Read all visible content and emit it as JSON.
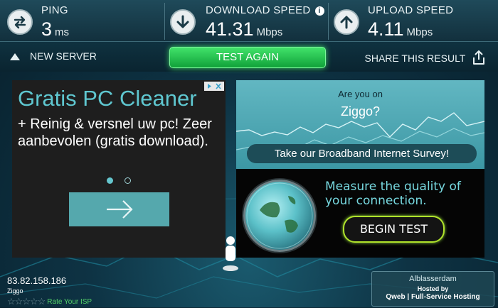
{
  "stats": {
    "ping": {
      "label": "PING",
      "value": "3",
      "unit": "ms"
    },
    "download": {
      "label": "DOWNLOAD SPEED",
      "value": "41.31",
      "unit": "Mbps"
    },
    "upload": {
      "label": "UPLOAD SPEED",
      "value": "4.11",
      "unit": "Mbps"
    }
  },
  "actions": {
    "new_server": "NEW SERVER",
    "test_again": "TEST AGAIN",
    "share": "SHARE THIS RESULT"
  },
  "ad_left": {
    "headline": "Gratis PC Cleaner",
    "body": "+ Reinig & versnel uw pc! Zeer aanbevolen (gratis download)."
  },
  "ad_right": {
    "question_line1": "Are you on",
    "question_line2": "Ziggo?",
    "survey": "Take our Broadband Internet Survey!",
    "measure": "Measure the quality of your connection.",
    "begin": "BEGIN TEST"
  },
  "footer": {
    "ip": "83.82.158.186",
    "isp": "Ziggo",
    "rate": "Rate Your ISP",
    "city": "Alblasserdam",
    "hosted_by": "Hosted by",
    "host": "Qweb | Full-Service Hosting"
  },
  "colors": {
    "accent": "#3cd768",
    "teal": "#5fc7d0"
  },
  "icons": [
    "ping-icon",
    "download-icon",
    "upload-icon",
    "info-icon",
    "triangle-up-icon",
    "share-icon",
    "adchoices-icon",
    "arrow-right-icon",
    "globe-icon",
    "star-icon"
  ]
}
